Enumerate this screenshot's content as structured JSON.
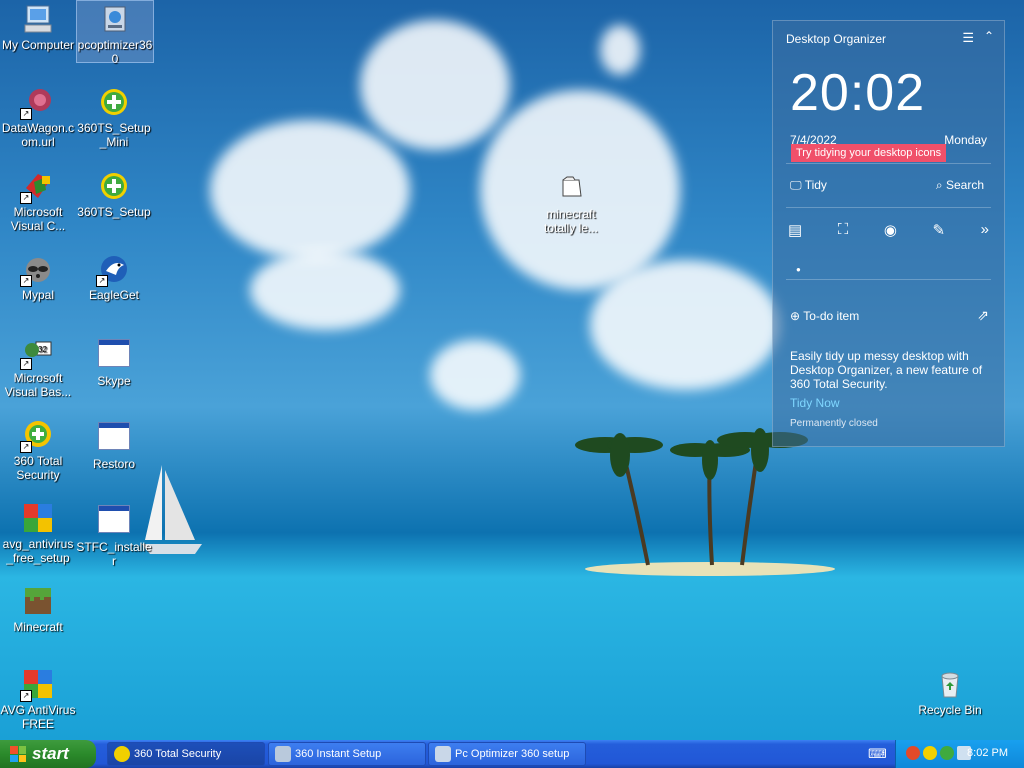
{
  "desktop": {
    "icons_left": [
      {
        "label": "My Computer",
        "icon": "computer-icon"
      },
      {
        "label": "DataWagon.com.url",
        "icon": "url-shortcut-icon"
      },
      {
        "label": "Microsoft Visual C...",
        "icon": "visual-c-icon"
      },
      {
        "label": "Mypal",
        "icon": "raccoon-browser-icon"
      },
      {
        "label": "Microsoft Visual Bas...",
        "icon": "visual-basic-icon"
      },
      {
        "label": "360 Total Security",
        "icon": "360-security-icon"
      },
      {
        "label": "avg_antivirus_free_setup",
        "icon": "avg-icon"
      },
      {
        "label": "Minecraft",
        "icon": "minecraft-grass-icon"
      },
      {
        "label": "AVG AntiVirus FREE",
        "icon": "avg-icon"
      }
    ],
    "icons_right": [
      {
        "label": "pcoptimizer360",
        "icon": "installer-icon"
      },
      {
        "label": "360TS_Setup_Mini",
        "icon": "360-setup-icon"
      },
      {
        "label": "360TS_Setup",
        "icon": "360-setup-icon"
      },
      {
        "label": "EagleGet",
        "icon": "eagle-icon"
      },
      {
        "label": "Skype",
        "icon": "window-icon"
      },
      {
        "label": "Restoro",
        "icon": "window-icon"
      },
      {
        "label": "STFC_installer",
        "icon": "window-icon"
      }
    ],
    "center_icon": {
      "label": "minecraft totally le...",
      "icon": "folder-icon"
    },
    "recycle_bin": {
      "label": "Recycle Bin",
      "icon": "recycle-bin-icon"
    }
  },
  "organizer": {
    "title": "Desktop Organizer",
    "time": "20:02",
    "date": "7/4/2022",
    "day": "Monday",
    "tip": "Try tidying your desktop icons",
    "tidy_label": "Tidy",
    "search_label": "Search",
    "todo_label": "To-do item",
    "description": "Easily tidy up messy desktop with Desktop Organizer, a new feature of 360 Total Security.",
    "tidy_now": "Tidy Now",
    "permanently_closed": "Permanently closed"
  },
  "taskbar": {
    "start_label": "start",
    "tasks": [
      {
        "label": "360 Total Security"
      },
      {
        "label": "360 Instant Setup"
      },
      {
        "label": "Pc Optimizer 360 setup"
      }
    ],
    "clock": "8:02 PM"
  },
  "colors": {
    "taskbar": "#245edb",
    "start": "#2b8a2b",
    "tip": "#f0506a",
    "link": "#7fd6ff"
  }
}
